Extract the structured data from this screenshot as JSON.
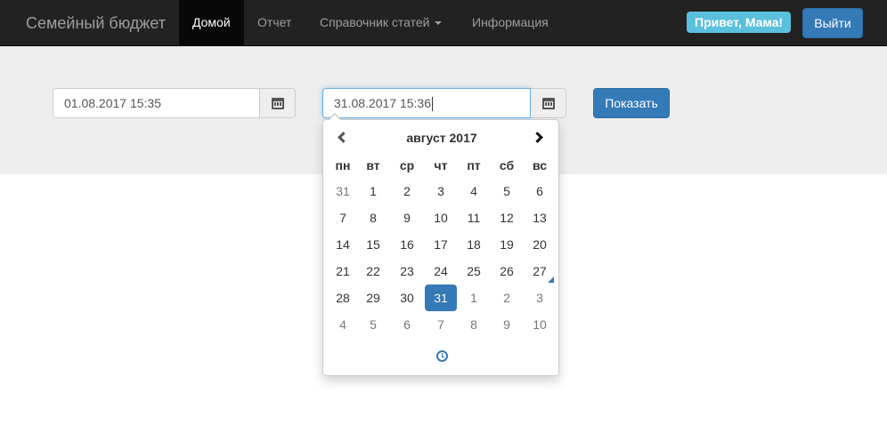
{
  "navbar": {
    "brand": "Семейный бюджет",
    "items": [
      {
        "label": "Домой",
        "active": true
      },
      {
        "label": "Отчет",
        "active": false
      },
      {
        "label": "Справочник статей",
        "active": false,
        "dropdown": true
      },
      {
        "label": "Информация",
        "active": false
      }
    ],
    "greeting": "Привет, Мама!",
    "logout_label": "Выйти"
  },
  "filter": {
    "date_from": "01.08.2017 15:35",
    "date_to": "31.08.2017 15:36",
    "show_label": "Показать"
  },
  "datepicker": {
    "month_title": "август 2017",
    "weekdays": [
      "пн",
      "вт",
      "ср",
      "чт",
      "пт",
      "сб",
      "вс"
    ],
    "weeks": [
      [
        "31",
        "1",
        "2",
        "3",
        "4",
        "5",
        "6"
      ],
      [
        "7",
        "8",
        "9",
        "10",
        "11",
        "12",
        "13"
      ],
      [
        "14",
        "15",
        "16",
        "17",
        "18",
        "19",
        "20"
      ],
      [
        "21",
        "22",
        "23",
        "24",
        "25",
        "26",
        "27"
      ],
      [
        "28",
        "29",
        "30",
        "31",
        "1",
        "2",
        "3"
      ],
      [
        "4",
        "5",
        "6",
        "7",
        "8",
        "9",
        "10"
      ]
    ],
    "selected_day": "31",
    "today_day": "27",
    "icons": {
      "prev": "chevron-left-icon",
      "next": "chevron-right-icon",
      "time": "clock-icon",
      "calendar": "calendar-icon"
    }
  },
  "colors": {
    "navbar_bg": "#222222",
    "primary": "#337ab7",
    "info": "#5bc0de",
    "jumbotron_bg": "#eeeeee"
  }
}
